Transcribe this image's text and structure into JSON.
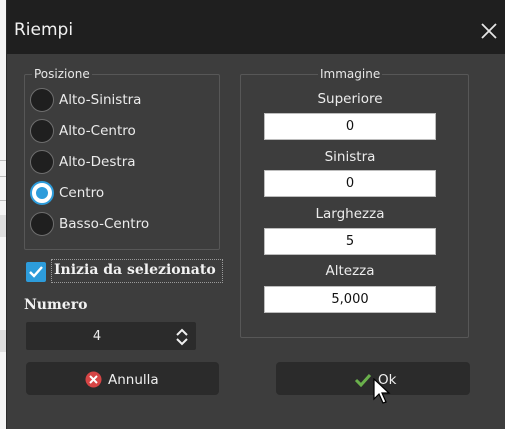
{
  "dialog": {
    "title": "Riempi"
  },
  "posizione": {
    "title": "Posizione",
    "options": [
      {
        "label": "Alto-Sinistra",
        "checked": false
      },
      {
        "label": "Alto-Centro",
        "checked": false
      },
      {
        "label": "Alto-Destra",
        "checked": false
      },
      {
        "label": "Centro",
        "checked": true
      },
      {
        "label": "Basso-Centro",
        "checked": false
      }
    ]
  },
  "immagine": {
    "title": "Immagine",
    "superiore_label": "Superiore",
    "superiore_value": "0",
    "sinistra_label": "Sinistra",
    "sinistra_value": "0",
    "larghezza_label": "Larghezza",
    "larghezza_value": "5",
    "altezza_label": "Altezza",
    "altezza_value": "5,000"
  },
  "inizia": {
    "label": "Inizia da selezionato",
    "checked": true
  },
  "numero": {
    "label": "Numero",
    "value": "4"
  },
  "buttons": {
    "cancel_label": "Annulla",
    "ok_label": "Ok"
  },
  "colors": {
    "accent": "#2d9cdb",
    "cancel_icon": "#d64545",
    "ok_icon": "#6ab04c",
    "dialog_bg": "#3d3d3d",
    "titlebar_bg": "#1f1f1f"
  }
}
